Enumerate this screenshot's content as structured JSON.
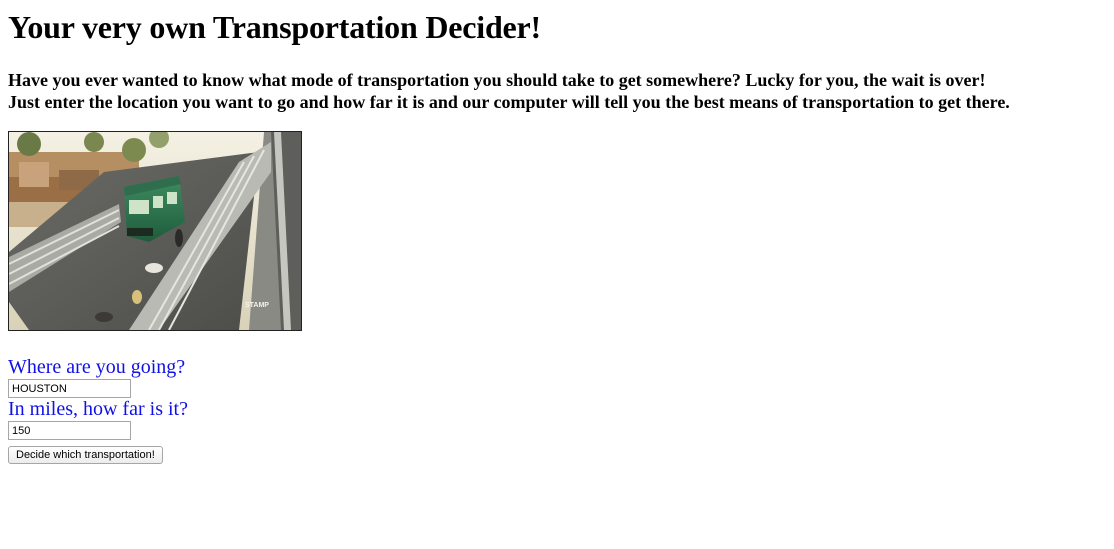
{
  "page": {
    "title": "Your very own Transportation Decider!",
    "intro_line1": "Have you ever wanted to know what mode of transportation you should take to get somewhere? Lucky for you, the wait is over!",
    "intro_line2": "Just enter the location you want to go and how far it is and our computer will tell you the best means of transportation to get there."
  },
  "image": {
    "watermark": "STAMP"
  },
  "form": {
    "destination_label": "Where are you going?",
    "destination_value": "HOUSTON",
    "distance_label": "In miles, how far is it?",
    "distance_value": "150",
    "submit_label": "Decide which transportation!"
  },
  "colors": {
    "question_text": "#1010e8",
    "heading_text": "#000000"
  }
}
